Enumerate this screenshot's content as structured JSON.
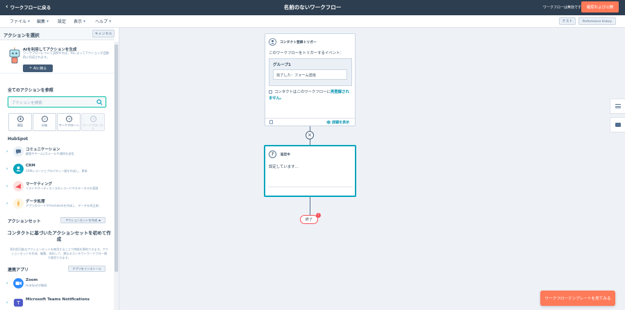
{
  "topbar": {
    "back_label": "ワークフローに戻る",
    "title": "名前のないワークフロー",
    "status": "ワークフローは無効です",
    "review_label": "確認および公開"
  },
  "menubar": {
    "menus": [
      "ファイル",
      "編集",
      "設定",
      "表示",
      "ヘルプ"
    ],
    "test_label": "テスト",
    "performance_label": "Performance history"
  },
  "panel": {
    "header_title": "アクションを選択",
    "cancel_label": "キャンセル",
    "ai": {
      "title": "AIを利用してアクションを生成",
      "description": "ワークフローについて説明すれば、AIによってアクションが自動的に作成されます。",
      "button_label": "AIに頼る"
    },
    "browse_title": "全てのアクションを参照",
    "search_placeholder": "アクションを検索",
    "filters": [
      {
        "label": "遅延",
        "icon": "clock-icon",
        "glyph": "⧗",
        "disabled": false
      },
      {
        "label": "分岐",
        "icon": "branch-icon",
        "glyph": "⑂",
        "disabled": false
      },
      {
        "label": "ワークフローへ",
        "icon": "arrow-right-icon",
        "glyph": "→",
        "disabled": false
      },
      {
        "label": "ワークフローから",
        "icon": "arrow-right-icon",
        "glyph": "→",
        "disabled": true
      }
    ],
    "hubspot_title": "HubSpot",
    "categories": [
      {
        "name": "コミュニケーション",
        "desc": "顧客やチームにEメールや通知を送信",
        "icon": "chat-icon",
        "color": "#516f90"
      },
      {
        "name": "CRM",
        "desc": "CRMレコードとプロパティー値を作成し、更新",
        "icon": "crm-icon",
        "color": "#00a4bd"
      },
      {
        "name": "マーケティング",
        "desc": "リストやオーディエンスのレコードやステータスを管理",
        "icon": "megaphone-icon",
        "color": "#f2545b"
      },
      {
        "name": "データ処理",
        "desc": "アプリのコードやFreshdeskを作成し、データを再正規...",
        "icon": "data-icon",
        "color": "#f5c26b"
      }
    ],
    "action_sets_title": "アクションセット",
    "create_set_label": "アクションセットを作成",
    "empty_title": "コンタクトに基づいたアクションセットを初めて作成",
    "empty_desc": "再利用可能なアクションセットを使用することで時間を節約できます。アクションセットを作成、編集、保存して、異なるコンタクトワークフロー間で使用できます。",
    "connected_apps_title": "連携アプリ",
    "install_app_label": "アプリをインストール",
    "apps": [
      {
        "name": "Zoom",
        "desc": "HubSpotが開発",
        "icon": "zoom-icon",
        "color": "#2d8cff"
      },
      {
        "name": "Microsoft Teams Notifications",
        "desc": "",
        "icon": "teams-icon",
        "color": "#5059c9"
      }
    ]
  },
  "canvas": {
    "trigger": {
      "title": "コンタクト登録トリガー",
      "question": "このワークフローをトリガーするイベント：",
      "group_title": "グループ1",
      "condition": "完了した：フォーム送信",
      "reenroll_text": "コンタクトはこのワークフローに",
      "reenroll_link": "再登録されません。",
      "details_label": "詳細を表示"
    },
    "action": {
      "title": "設定中",
      "body": "設定しています..."
    },
    "end_label": "終了",
    "end_badge": "!"
  },
  "template_button": "ワークフローテンプレートを見てみる",
  "colors": {
    "topbar": "#2d3e50",
    "accent_orange": "#ff7a59",
    "teal": "#00a4bd",
    "error_red": "#f2545b"
  }
}
